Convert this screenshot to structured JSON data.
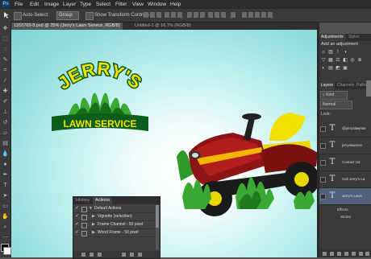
{
  "menubar": {
    "logo": "Ps",
    "items": [
      "File",
      "Edit",
      "Image",
      "Layer",
      "Type",
      "Select",
      "Filter",
      "View",
      "Window",
      "Help"
    ]
  },
  "options_bar": {
    "auto_select_label": "Auto-Select:",
    "auto_select_value": "Group",
    "show_transform_label": "Show Transform Controls"
  },
  "document_tabs": [
    {
      "label": "1310769-8.psd @ 25% (Jerry's Lawn  Service, RGB/8)",
      "active": true
    },
    {
      "label": "Untitled-1 @ 16.7% (RGB/8)",
      "active": false
    }
  ],
  "logo_art": {
    "top_text": "JERRY'S",
    "banner_text": "LAWN SERVICE",
    "colors": {
      "green": "#3aa832",
      "dark_green": "#1a6b1a",
      "yellow": "#f2e000",
      "banner": "#0c5e1a"
    }
  },
  "history_panel": {
    "tabs": [
      "History",
      "Actions"
    ],
    "active_tab": "Actions",
    "rows": [
      "Default Actions",
      "Vignette (selection)",
      "Frame Channel - 50 pixel",
      "Wood Frame - 50 pixel"
    ]
  },
  "right_panel": {
    "top_tabs": [
      "Adjustments",
      "Styles"
    ],
    "adjustments_title": "Add an adjustment",
    "layer_tabs": [
      "Layers",
      "Channels",
      "Paths"
    ],
    "kind_label": "Kind",
    "blend_mode": "Normal",
    "lock_label": "Lock:",
    "layers": [
      {
        "name": "@jerryslawnse",
        "selected": false
      },
      {
        "name": "jerryslawnse",
        "selected": false
      },
      {
        "name": "Contact Us:",
        "selected": false
      },
      {
        "name": "Call Jerry's La",
        "selected": false
      },
      {
        "name": "Jerry's Lawn",
        "selected": true
      }
    ],
    "effects_label": "Effects",
    "stroke_label": "Stroke"
  }
}
